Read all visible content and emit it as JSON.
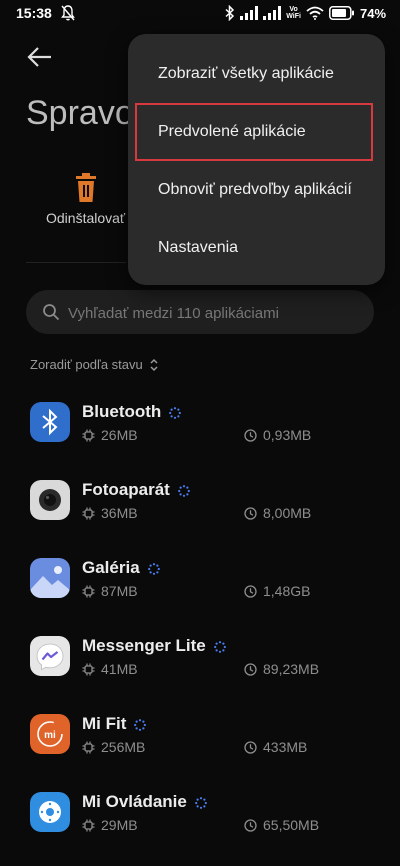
{
  "status_bar": {
    "time": "15:38",
    "network_label_top": "Vo",
    "network_label_bottom": "WiFi",
    "battery": "74"
  },
  "page": {
    "title": "Spravov",
    "uninstall_label": "Odinštalovať"
  },
  "search": {
    "placeholder": "Vyhľadať medzi 110 aplikáciami"
  },
  "sort": {
    "label": "Zoradiť podľa stavu"
  },
  "apps": [
    {
      "name": "Bluetooth",
      "app_size": "26MB",
      "data_size": "0,93MB",
      "icon": "bluetooth-icon",
      "color": "#2f6fcb"
    },
    {
      "name": "Fotoaparát",
      "app_size": "36MB",
      "data_size": "8,00MB",
      "icon": "camera-icon",
      "color": "#d9d9d9"
    },
    {
      "name": "Galéria",
      "app_size": "87MB",
      "data_size": "1,48GB",
      "icon": "gallery-icon",
      "color": "#6a8de0"
    },
    {
      "name": "Messenger Lite",
      "app_size": "41MB",
      "data_size": "89,23MB",
      "icon": "messenger-icon",
      "color": "#e6e6e6"
    },
    {
      "name": "Mi Fit",
      "app_size": "256MB",
      "data_size": "433MB",
      "icon": "mi-fit-icon",
      "color": "#e0632a"
    },
    {
      "name": "Mi Ovládanie",
      "app_size": "29MB",
      "data_size": "65,50MB",
      "icon": "remote-icon",
      "color": "#2f8ee0"
    }
  ],
  "menu": {
    "items": [
      {
        "label": "Zobraziť všetky aplikácie"
      },
      {
        "label": "Predvolené aplikácie",
        "highlighted": true
      },
      {
        "label": "Obnoviť predvoľby aplikácií"
      },
      {
        "label": "Nastavenia"
      }
    ]
  },
  "colors": {
    "background": "#0a0a0a",
    "menu_bg": "#2b2b2b",
    "highlight": "#d8393f",
    "uninstall_accent": "#e0782a",
    "loading_dots": "#4a7df0"
  }
}
